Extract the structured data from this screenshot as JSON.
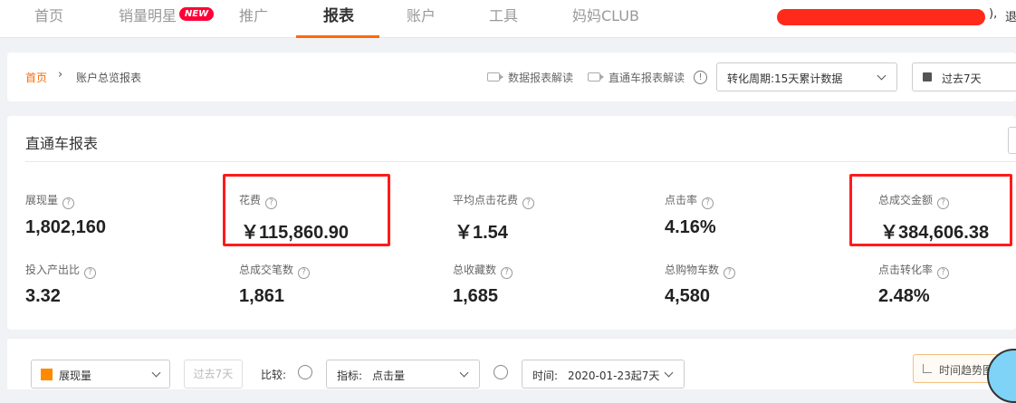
{
  "nav": {
    "items": [
      "首页",
      "销量明星",
      "推广",
      "报表",
      "账户",
      "工具",
      "妈妈CLUB"
    ],
    "badge": "NEW",
    "tail": "),",
    "tail2": "退"
  },
  "breadcrumb": {
    "home": "首页",
    "separator": "›",
    "current": "账户总览报表",
    "link1": "数据报表解读",
    "link2": "直通车报表解读",
    "info": "!",
    "period_select": "转化周期:15天累计数据",
    "date_select": "过去7天"
  },
  "card": {
    "title": "直通车报表",
    "metrics_row1": [
      {
        "label": "展现量",
        "value": "1,802,160"
      },
      {
        "label": "花费",
        "value": "￥115,860.90"
      },
      {
        "label": "平均点击花费",
        "value": "￥1.54"
      },
      {
        "label": "点击率",
        "value": "4.16%"
      },
      {
        "label": "总成交金额",
        "value": "￥384,606.38"
      }
    ],
    "metrics_row2": [
      {
        "label": "投入产出比",
        "value": "3.32"
      },
      {
        "label": "总成交笔数",
        "value": "1,861"
      },
      {
        "label": "总收藏数",
        "value": "1,685"
      },
      {
        "label": "总购物车数",
        "value": "4,580"
      },
      {
        "label": "点击转化率",
        "value": "2.48%"
      }
    ],
    "q": "?"
  },
  "chartbar": {
    "metric_select": "展现量",
    "range_btn": "过去7天",
    "compare_label": "比较:",
    "indicator_prefix": "指标:",
    "indicator_value": "点击量",
    "time_prefix": "时间:",
    "time_value": "2020-01-23起7天",
    "trend_btn": "时间趋势图"
  },
  "colors": {
    "accent": "#ff6a00",
    "highlight": "#ff1a1a",
    "badge": "#ff0036",
    "series": "#ff8a00"
  }
}
